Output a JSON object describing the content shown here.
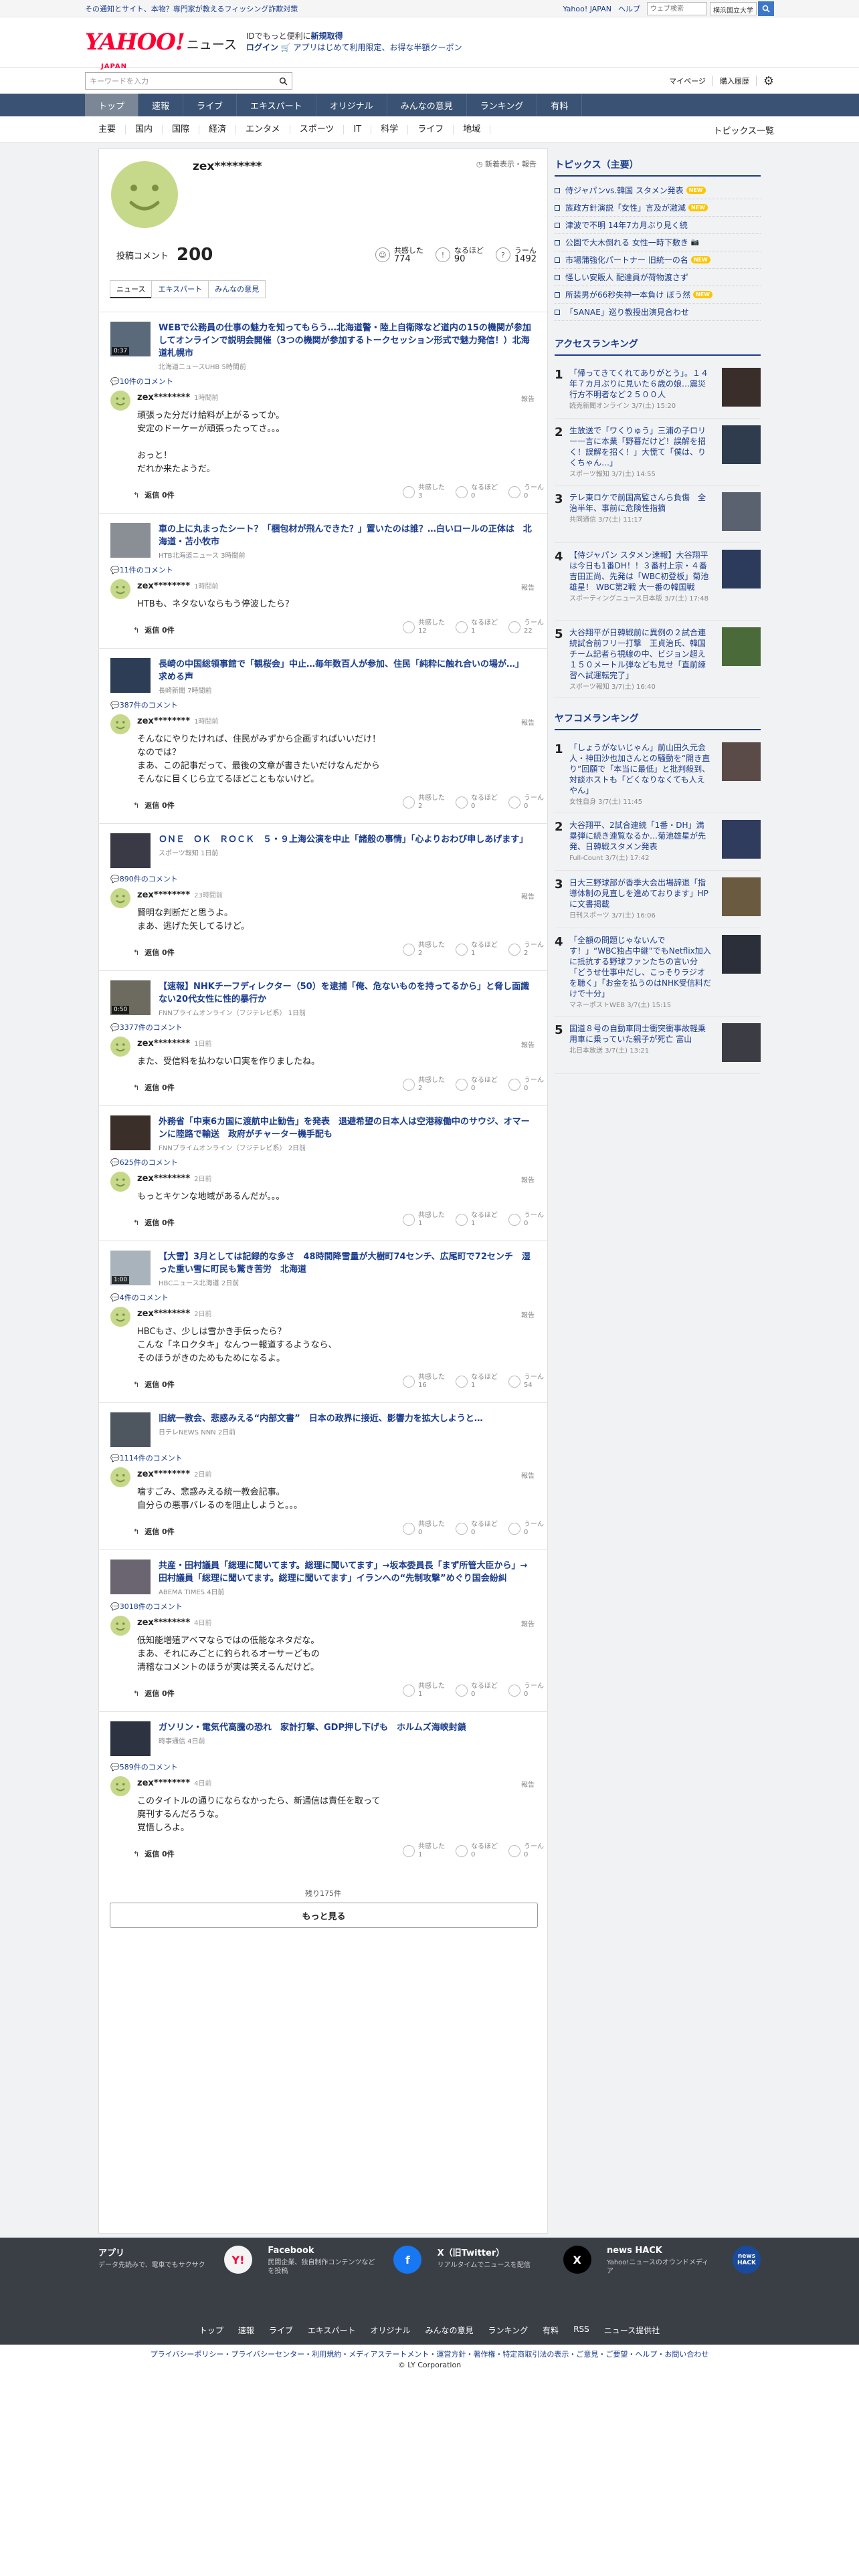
{
  "promo": {
    "text": "その通知とサイト、本物？専門家が教えるフィッシング詐欺対策",
    "yahoo_japan": "Yahoo! JAPAN",
    "help": "ヘルプ",
    "web_search_placeholder": "ウェブ検索",
    "location": "横浜国立大学"
  },
  "logo": {
    "y": "YAHOO!",
    "news": "ニュース",
    "japan": "JAPAN"
  },
  "header_promo": {
    "line1_pre": "IDでもっと便利に",
    "line1_link": "新規取得",
    "login": "ログイン",
    "rest": "アプリはじめて利用限定、お得な半額クーポン"
  },
  "search": {
    "placeholder": "キーワードを入力",
    "mypage": "マイページ",
    "history": "購入履歴"
  },
  "nav": [
    "トップ",
    "速報",
    "ライブ",
    "エキスパート",
    "オリジナル",
    "みんなの意見",
    "ランキング",
    "有料"
  ],
  "subnav": [
    "主要",
    "国内",
    "国際",
    "経済",
    "エンタメ",
    "スポーツ",
    "IT",
    "科学",
    "ライフ",
    "地域"
  ],
  "all_topics": "トピックス一覧",
  "profile": {
    "name": "zex********",
    "new_order": "新着表示・報告",
    "comment_label": "投稿コメント",
    "comment_count": "200",
    "reactions": [
      {
        "label": "共感した",
        "value": "774",
        "icon": "☺"
      },
      {
        "label": "なるほど",
        "value": "90",
        "icon": "!"
      },
      {
        "label": "うーん",
        "value": "1492",
        "icon": "?"
      }
    ],
    "tabs": [
      "ニュース",
      "エキスパート",
      "みんなの意見"
    ]
  },
  "entries": [
    {
      "title": "WEBで公務員の仕事の魅力を知ってもらう…北海道警・陸上自衛隊など道内の15の機関が参加してオンラインで説明会開催（3つの機関が参加するトークセッション形式で魅力発信！）北海道札幌市",
      "source": "北海道ニュースUHB 5時間前",
      "duration": "0:37",
      "comments": "10件のコメント",
      "user": "zex********",
      "time": "1時間前",
      "text": "頑張った分だけ給料が上がるってか。\n安定のドーケーが頑張ったってさ。。。\n\nおっと！\nだれか来たようだ。",
      "r": [
        "3",
        "0",
        "0"
      ],
      "reply": "返信 0件"
    },
    {
      "title": "車の上に丸まったシート？「梱包材が飛んできた？」置いたのは誰？…白いロールの正体は　北海道・苫小牧市",
      "source": "HTB北海道ニュース 3時間前",
      "comments": "11件のコメント",
      "user": "zex********",
      "time": "1時間前",
      "text": "HTBも、ネタないならもう停波したら？",
      "r": [
        "12",
        "1",
        "22"
      ],
      "reply": "返信 0件"
    },
    {
      "title": "長崎の中国総領事館で「観桜会」中止…毎年数百人が参加、住民「純粋に触れ合いの場が…」求める声",
      "source": "長崎新聞 7時間前",
      "comments": "387件のコメント",
      "user": "zex********",
      "time": "1時間前",
      "text": "そんなにやりたければ、住民がみずから企画すればいいだけ！\nなのでは？\nまあ、この記事だって、最後の文章が書きたいだけなんだから\nそんなに目くじら立てるほどこともないけど。",
      "r": [
        "2",
        "0",
        "0"
      ],
      "reply": "返信 0件"
    },
    {
      "title": "ＯＮＥ　ＯＫ　ＲＯＣＫ　５・９上海公演を中止「諸般の事情」「心よりおわび申しあげます」",
      "source": "スポーツ報知 1日前",
      "comments": "890件のコメント",
      "user": "zex********",
      "time": "23時間前",
      "text": "賢明な判断だと思うよ。\nまあ、逃げた矢してるけど。",
      "r": [
        "2",
        "1",
        "2"
      ],
      "reply": "返信 0件"
    },
    {
      "title": "【速報】NHKチーフディレクター（50）を逮捕「俺、危ないものを持ってるから」と脅し面識ない20代女性に性的暴行か",
      "source": "FNNプライムオンライン（フジテレビ系） 1日前",
      "duration": "0:50",
      "comments": "3377件のコメント",
      "user": "zex********",
      "time": "1日前",
      "text": "また、受信料を払わない口実を作りましたね。",
      "r": [
        "2",
        "0",
        "0"
      ],
      "reply": "返信 0件"
    },
    {
      "title": "外務省「中東6カ国に渡航中止勧告」を発表　退避希望の日本人は空港稼働中のサウジ、オマーンに陸路で輸送　政府がチャーター機手配も",
      "source": "FNNプライムオンライン（フジテレビ系） 2日前",
      "comments": "625件のコメント",
      "user": "zex********",
      "time": "2日前",
      "text": "もっとキケンな地域があるんだが。。。",
      "r": [
        "1",
        "1",
        "0"
      ],
      "reply": "返信 0件"
    },
    {
      "title": "【大雪】3月としては記録的な多さ　48時間降雪量が大樹町74センチ、広尾町で72センチ　湿った重い雪に町民も驚き苦労　北海道",
      "source": "HBCニュース北海道 2日前",
      "duration": "1:00",
      "comments": "4件のコメント",
      "user": "zex********",
      "time": "2日前",
      "text": "HBCもさ、少しは雪かき手伝ったら？\nこんな「ネロクタキ」なんつー報道するようなら、\nそのほうがきのためもためになるよ。",
      "r": [
        "16",
        "1",
        "54"
      ],
      "reply": "返信 0件"
    },
    {
      "title": "旧統一教会、悲惑みえる“内部文書”　日本の政界に接近、影響力を拡大しようと…",
      "source": "日テレNEWS NNN 2日前",
      "comments": "1114件のコメント",
      "user": "zex********",
      "time": "2日前",
      "text": "噛すごみ、悲惑みえる統一教会記事。\n自分らの悪事バレるのを阻止しようと。。。",
      "r": [
        "0",
        "0",
        "0"
      ],
      "reply": "返信 0件"
    },
    {
      "title": "共産・田村議員「総理に聞いてます。総理に聞いてます」→坂本委員長「まず所管大臣から」→田村議員「総理に聞いてます。総理に聞いてます」イランへの“先制攻撃”めぐり国会紛糾",
      "source": "ABEMA TIMES 4日前",
      "comments": "3018件のコメント",
      "user": "zex********",
      "time": "4日前",
      "text": "低知能増殖アベマならではの低能なネタだな。\nまあ、それにみごとに釣られるオーサーどもの\n清稽なコメントのほうが実は笑えるんだけど。",
      "r": [
        "1",
        "0",
        "0"
      ],
      "reply": "返信 0件"
    },
    {
      "title": "ガソリン・電気代高騰の恐れ　家計打撃、GDP押し下げも　ホルムズ海峡封鎖",
      "source": "時事通信 4日前",
      "comments": "589件のコメント",
      "user": "zex********",
      "time": "4日前",
      "text": "このタイトルの通りにならなかったら、新通信は責任を取って\n廃刊するんだろうな。\n覚悟しろよ。",
      "r": [
        "1",
        "0",
        "0"
      ],
      "reply": "返信 0件"
    }
  ],
  "remaining": "残り175件",
  "more": "もっと見る",
  "sidebar": {
    "topics_head": "トピックス（主要）",
    "topics": [
      {
        "t": "侍ジャパンvs.韓国 スタメン発表",
        "b": "new"
      },
      {
        "t": "族政方針演説「女性」言及が激減",
        "b": "new"
      },
      {
        "t": "津波で不明 14年7カ月ぶり見く続",
        "b": ""
      },
      {
        "t": "公園で大木倒れる 女性一時下敷き",
        "b": "cam"
      },
      {
        "t": "市場蒲強化パートナー 旧統一の名",
        "b": "new"
      },
      {
        "t": "怪しい安販人 配達員が荷物渡さず",
        "b": ""
      },
      {
        "t": "所装男が66秒失神一本負け ぼう然",
        "b": "new"
      },
      {
        "t": "「SANAE」巡り教授出演見合わせ",
        "b": ""
      }
    ],
    "access_head": "アクセスランキング",
    "access": [
      {
        "t": "「帰ってきてくれてありがとう」。１４年７カ月ぶりに見いた６歳の娘…震災行方不明者など２５００人",
        "s": "読売新聞オンライン 3/7(土) 15:20"
      },
      {
        "t": "生放送で「ワくりゅう」三浦の子ロリー一言に本業「野暮だけど！誤解を招く！誤解を招く！」大慌て「僕は、りくちゃん…」",
        "s": "スポーツ報知 3/7(土) 14:55"
      },
      {
        "t": "テレ東ロケで前国高監さんら負傷　全治半年、事前に危険性指摘",
        "s": "共同通信 3/7(土) 11:17"
      },
      {
        "t": "【侍ジャパン スタメン速報】大谷翔平は今日も1番DH！！３番村上宗・４番吉田正尚、先発は「WBC初登板」菊池雄星！ WBC第2戦 大一番の韓国戦",
        "s": "スポーティングニュース日本版 3/7(土) 17:48"
      },
      {
        "t": "大谷翔平が日韓戦前に異例の２試合連続試合前フリー打撃　王貞治氏、韓国チーム記者ら視線の中、ビジョン超え１５０メートル弾なども見せ「直前練習へ試運転完了」",
        "s": "スポーツ報知 3/7(土) 16:40"
      }
    ],
    "yafuko_head": "ヤフコメランキング",
    "yafuko": [
      {
        "t": "「しょうがないじゃん」前山田久元会人・神田沙也加さんとの騒動を“開き直り”回願で「本当に最低」と批判殺到、対談ホストも「どくなりなくても人えやん」",
        "s": "女性自身 3/7(土) 11:45"
      },
      {
        "t": "大谷翔平、2試合連続「1番・DH」満塁弾に続き連覧なるか…菊池雄星が先発、日韓戦スタメン発表",
        "s": "Full-Count 3/7(土) 17:42"
      },
      {
        "t": "日大三野球部が香季大会出場辞退「指導体制の見直しを進めております」HPに文書掲載",
        "s": "日刊スポーツ 3/7(土) 16:06"
      },
      {
        "t": "「全額の問題じゃないんです！」“WBC独占中継”でもNetflix加入に抵抗する野球ファンたちの言い分「どうせ仕事中だし、こっそりラジオを聴く」「お金を払うのはNHK受信料だけで十分」",
        "s": "マネーポストWEB 3/7(土) 15:15"
      },
      {
        "t": "国道８号の自動車同士衝突衝事故軽乗用車に乗っていた親子が死亡 富山",
        "s": "北日本放送 3/7(土) 13:21"
      }
    ]
  },
  "apps": [
    {
      "t": "アプリ",
      "d": "データ先読みで、電車でもサクサク",
      "i": "Y!"
    },
    {
      "t": "Facebook",
      "d": "民間企業、独自制作コンテンツなどを投稿",
      "i": "f"
    },
    {
      "t": "X（旧Twitter）",
      "d": "リアルタイムでニュースを配信",
      "i": "X"
    },
    {
      "t": "news HACK",
      "d": "Yahoo!ニュースのオウンドメディア",
      "i": "news HACK"
    }
  ],
  "footer_nav": [
    "トップ",
    "速報",
    "ライブ",
    "エキスパート",
    "オリジナル",
    "みんなの意見",
    "ランキング",
    "有料",
    "RSS",
    "ニュース提供社"
  ],
  "legal": "プライバシーポリシー・プライバシーセンター・利用規約・メディアステートメント・運営方針・著作権・特定商取引法の表示・ご意見・ご要望・ヘルプ・お問い合わせ",
  "copyright": "© LY Corporation"
}
